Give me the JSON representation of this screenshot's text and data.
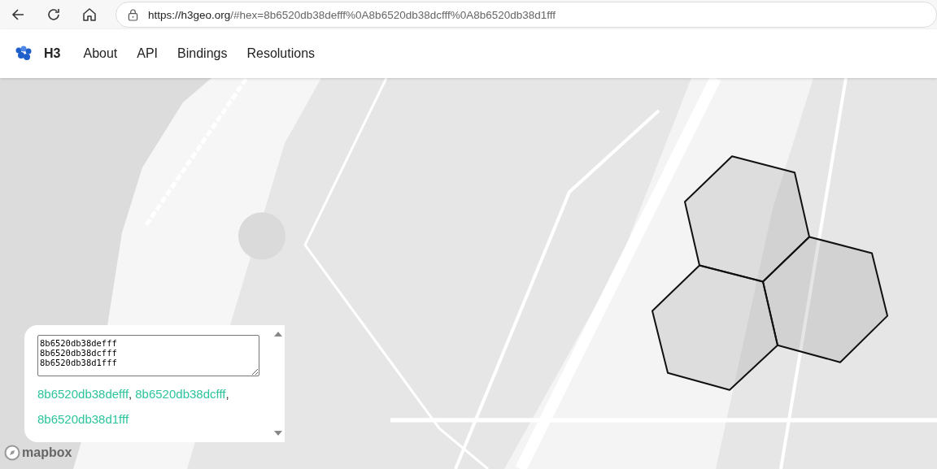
{
  "browser": {
    "url_host": "https://h3geo.org",
    "url_rest": "/#hex=8b6520db38defff%0A8b6520db38dcfff%0A8b6520db38d1fff"
  },
  "nav": {
    "brand": "H3",
    "links": [
      "About",
      "API",
      "Bindings",
      "Resolutions"
    ]
  },
  "panel": {
    "input": {
      "value": "8b6520db38defff\n8b6520db38dcfff\n8b6520db38d1fff"
    },
    "cells": [
      {
        "label": "8b6520db38defff",
        "separator": ","
      },
      {
        "label": "8b6520db38dcfff",
        "separator": ","
      },
      {
        "label": "8b6520db38d1fff"
      }
    ]
  },
  "attribution": "mapbox"
}
